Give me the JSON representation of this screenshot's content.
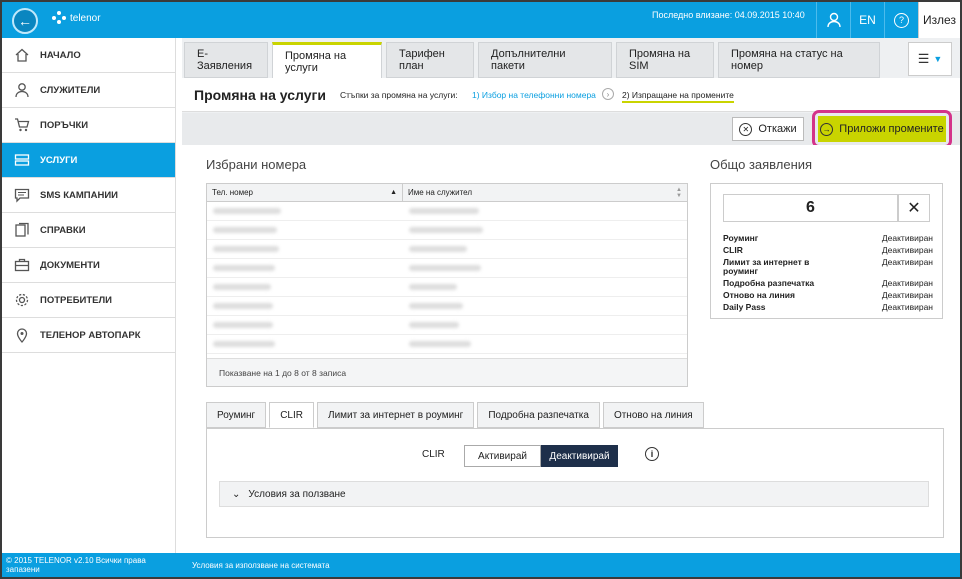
{
  "topbar": {
    "logo_text": "telenor",
    "last_login": "Последно влизане: 04.09.2015 10:40",
    "lang": "EN",
    "help": "?",
    "exit": "Излез"
  },
  "sidebar": {
    "items": [
      {
        "label": "НАЧАЛО",
        "icon": "home-icon"
      },
      {
        "label": "СЛУЖИТЕЛИ",
        "icon": "user-icon"
      },
      {
        "label": "ПОРЪЧКИ",
        "icon": "cart-icon"
      },
      {
        "label": "УСЛУГИ",
        "icon": "phone-icon",
        "active": true
      },
      {
        "label": "SMS КАМПАНИИ",
        "icon": "sms-icon"
      },
      {
        "label": "СПРАВКИ",
        "icon": "report-icon"
      },
      {
        "label": "ДОКУМЕНТИ",
        "icon": "briefcase-icon"
      },
      {
        "label": "ПОТРЕБИТЕЛИ",
        "icon": "gear-icon"
      },
      {
        "label": "ТЕЛЕНОР АВТОПАРК",
        "icon": "location-pin-icon"
      }
    ]
  },
  "tabs": [
    "E-Заявления",
    "Промяна на услуги",
    "Тарифен план",
    "Допълнителни пакети",
    "Промяна на SIM",
    "Промяна на статус на номер"
  ],
  "header": {
    "title": "Промяна на услуги",
    "steps_label": "Стъпки за промяна на услуги:",
    "step1": "1) Избор на телефонни номера",
    "step2": "2) Изпращане на промените"
  },
  "actions": {
    "cancel": "Откажи",
    "apply": "Приложи промените"
  },
  "selected": {
    "title": "Избрани номера",
    "col_phone": "Тел. номер",
    "col_name": "Име на служител",
    "footer": "Показване на 1 до 8 от 8 записа"
  },
  "summary": {
    "title": "Общо заявления",
    "count": "6",
    "rows": [
      {
        "name": "Роуминг",
        "status": "Деактивиран"
      },
      {
        "name": "CLIR",
        "status": "Деактивиран"
      },
      {
        "name": "Лимит за интернет в роуминг",
        "status": "Деактивиран"
      },
      {
        "name": "Подробна разпечатка",
        "status": "Деактивиран"
      },
      {
        "name": "Отново на линия",
        "status": "Деактивиран"
      },
      {
        "name": "Daily Pass",
        "status": "Деактивиран"
      }
    ]
  },
  "service_tabs": [
    "Роуминг",
    "CLIR",
    "Лимит за интернет в роуминг",
    "Подробна разпечатка",
    "Отново на линия"
  ],
  "clir": {
    "label": "CLIR",
    "activate": "Активирай",
    "deactivate": "Деактивирай",
    "terms": "Условия за ползване"
  },
  "footer": {
    "copyright": "© 2015 TELENOR v2.10 Всички права запазени",
    "terms": "Условия за използване на системата"
  },
  "colors": {
    "brand": "#0a9fe0",
    "accent": "#c9d400",
    "highlight": "#d4338a",
    "toggle_on": "#1e2f4a"
  }
}
